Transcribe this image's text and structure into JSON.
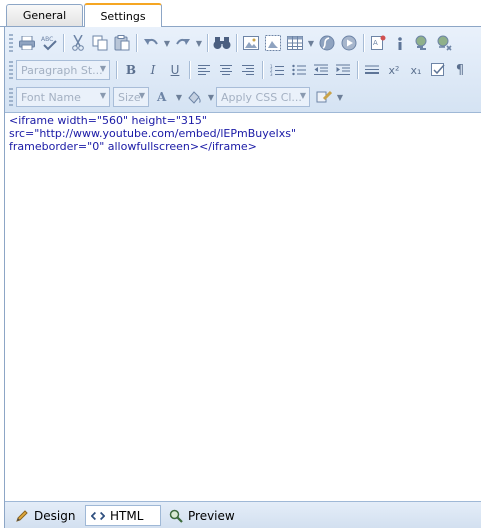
{
  "tabs": [
    {
      "label": "General"
    },
    {
      "label": "Settings"
    }
  ],
  "toolbar": {
    "paragraph_style": "Paragraph St...",
    "font_name": "Font Name",
    "size": "Size",
    "apply_css_class": "Apply CSS Cl...",
    "bold": "B",
    "italic": "I",
    "underline": "U",
    "superscript": "x²",
    "subscript": "x₁",
    "pilcrow": "¶"
  },
  "content": {
    "line1": "<iframe width=\"560\" height=\"315\" src=\"http://www.youtube.com/embed/lEPmBuyeIxs\"",
    "line2": "frameborder=\"0\" allowfullscreen></iframe>"
  },
  "modes": {
    "design": "Design",
    "html": "HTML",
    "preview": "Preview"
  },
  "colors": {
    "accent_tab": "#f5a623",
    "toolbar_bg": "#dce8f5",
    "code_text": "#1a1aa6"
  }
}
